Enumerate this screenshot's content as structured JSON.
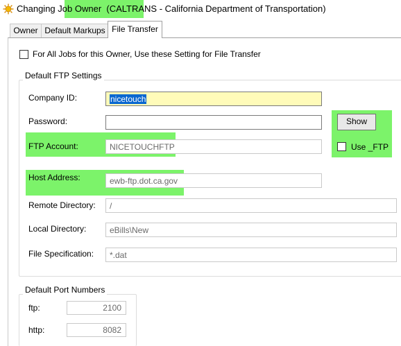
{
  "window": {
    "title_prefix": "Changing ",
    "title_highlight": "Job Owner  (CALTRANS",
    "title_suffix": " - California Department of Transportation)"
  },
  "tabs": [
    {
      "label": "Owner",
      "active": false
    },
    {
      "label": "Default Markups",
      "active": false
    },
    {
      "label": "File Transfer",
      "active": true
    }
  ],
  "file_transfer": {
    "all_jobs_checkbox_label": "For All Jobs for this Owner, Use these Setting for File Transfer",
    "ftp_group_title": "Default FTP Settings",
    "company_id_label": "Company ID:",
    "company_id_value": "nicetouch",
    "password_label": "Password:",
    "password_value": "",
    "show_button": "Show",
    "use_ftp_label": "Use _FTP",
    "ftp_account_label": "FTP Account:",
    "ftp_account_value": "NICETOUCHFTP",
    "host_address_label": "Host Address:",
    "host_address_value": "ewb-ftp.dot.ca.gov",
    "remote_dir_label": "Remote Directory:",
    "remote_dir_value": "/",
    "local_dir_label": "Local Directory:",
    "local_dir_value": "eBills\\New",
    "file_spec_label": "File Specification:",
    "file_spec_value": "*.dat",
    "port_group_title": "Default Port Numbers",
    "ftp_port_label": "ftp:",
    "ftp_port_value": "2100",
    "http_port_label": "http:",
    "http_port_value": "8082"
  },
  "colors": {
    "highlight": "#7cf36a",
    "active_field_bg": "#fffbb9",
    "selection": "#0a67d0"
  }
}
